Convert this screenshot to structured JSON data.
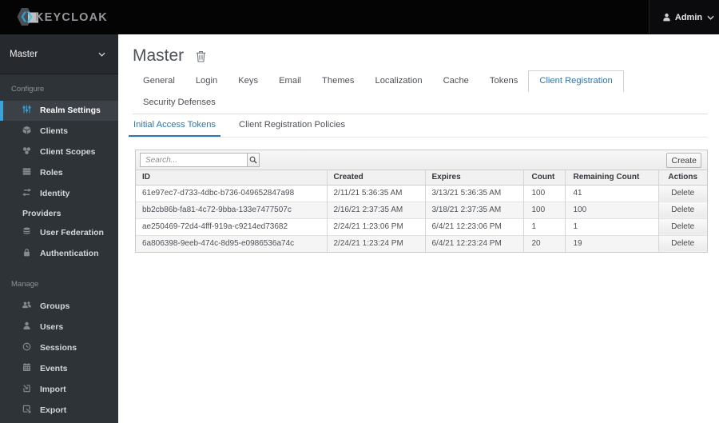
{
  "topbar": {
    "brand": "KEYCLOAK",
    "user": "Admin"
  },
  "sidebar": {
    "realm": "Master",
    "configure_label": "Configure",
    "manage_label": "Manage",
    "configure_items": [
      "Realm Settings",
      "Clients",
      "Client Scopes",
      "Roles",
      "Identity Providers",
      "User Federation",
      "Authentication"
    ],
    "manage_items": [
      "Groups",
      "Users",
      "Sessions",
      "Events",
      "Import",
      "Export"
    ]
  },
  "main": {
    "title": "Master",
    "tabs": [
      "General",
      "Login",
      "Keys",
      "Email",
      "Themes",
      "Localization",
      "Cache",
      "Tokens",
      "Client Registration",
      "Security Defenses"
    ],
    "active_tab": "Client Registration",
    "subtabs": [
      "Initial Access Tokens",
      "Client Registration Policies"
    ],
    "active_subtab": "Initial Access Tokens",
    "toolbar": {
      "search_placeholder": "Search...",
      "create_label": "Create"
    },
    "table": {
      "columns": [
        "ID",
        "Created",
        "Expires",
        "Count",
        "Remaining Count",
        "Actions"
      ],
      "action_label": "Delete",
      "rows": [
        {
          "id": "61e97ec7-d733-4dbc-b736-049652847a98",
          "created": "2/11/21 5:36:35 AM",
          "expires": "3/13/21 5:36:35 AM",
          "count": "100",
          "remaining": "41"
        },
        {
          "id": "bb2cb86b-fa81-4c72-9bba-133e7477507c",
          "created": "2/16/21 2:37:35 AM",
          "expires": "3/18/21 2:37:35 AM",
          "count": "100",
          "remaining": "100"
        },
        {
          "id": "ae250469-72d4-4fff-919a-c9214ed73682",
          "created": "2/24/21 1:23:06 PM",
          "expires": "6/4/21 12:23:06 PM",
          "count": "1",
          "remaining": "1"
        },
        {
          "id": "6a806398-9eeb-474c-8d95-e0986536a74c",
          "created": "2/24/21 1:23:24 PM",
          "expires": "6/4/21 12:23:24 PM",
          "count": "20",
          "remaining": "19"
        }
      ]
    }
  },
  "colors": {
    "accent_blue": "#2e76b5",
    "sidebar_accent": "#3ba1d9",
    "sidebar_bg": "#2e3338",
    "topbar_bg": "#040404"
  }
}
